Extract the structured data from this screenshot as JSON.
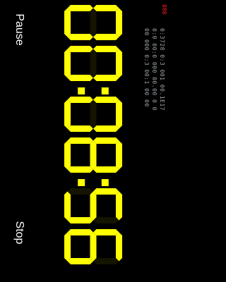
{
  "buttons": {
    "pause_label": "Pause",
    "stop_label": "Stop"
  },
  "timer": {
    "display": "00:08:56"
  },
  "status": {
    "indicator_text": "888",
    "lines": [
      "0:3728 0:3 001 00.1E17",
      "0:0 00:0 000 00.00 0 0",
      "00 000 0:3 00:1 00 00"
    ]
  },
  "colors": {
    "segment_on": "#ffff00",
    "segment_off": "#141400",
    "background": "#000000",
    "button_text": "#ffffff",
    "status_red": "#ff2020",
    "status_gray": "#9aa0a6"
  }
}
